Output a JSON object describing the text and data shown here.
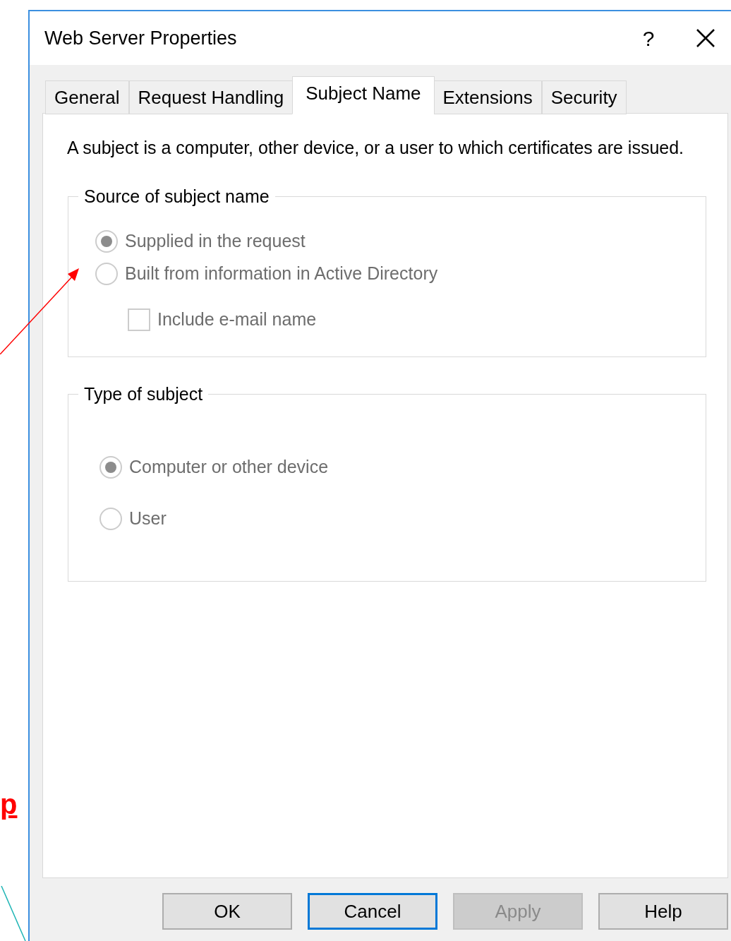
{
  "window": {
    "title": "Web Server Properties",
    "help_button": "?"
  },
  "tabs": [
    {
      "label": "General",
      "selected": false
    },
    {
      "label": "Request Handling",
      "selected": false
    },
    {
      "label": "Subject Name",
      "selected": true
    },
    {
      "label": "Extensions",
      "selected": false
    },
    {
      "label": "Security",
      "selected": false
    }
  ],
  "description": "A subject is a computer, other device, or a user to which certificates are issued.",
  "groups": [
    {
      "label": "Source of subject name",
      "options": [
        {
          "kind": "radio",
          "label": "Supplied in the request",
          "selected": true,
          "disabled": true
        },
        {
          "kind": "radio",
          "label": "Built from information in Active Directory",
          "selected": false,
          "disabled": true
        },
        {
          "kind": "checkbox",
          "label": "Include e-mail name",
          "checked": false,
          "disabled": true
        }
      ]
    },
    {
      "label": "Type of subject",
      "options": [
        {
          "kind": "radio",
          "label": "Computer or other device",
          "selected": true,
          "disabled": true
        },
        {
          "kind": "radio",
          "label": "User",
          "selected": false,
          "disabled": true
        }
      ]
    }
  ],
  "buttons": [
    {
      "label": "OK",
      "default": false,
      "disabled": false
    },
    {
      "label": "Cancel",
      "default": true,
      "disabled": false
    },
    {
      "label": "Apply",
      "default": false,
      "disabled": true
    },
    {
      "label": "Help",
      "default": false,
      "disabled": false
    }
  ],
  "annotation": {
    "text": "p"
  }
}
